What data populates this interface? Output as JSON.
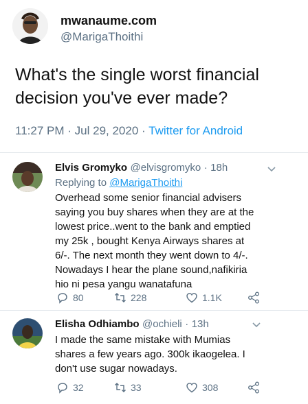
{
  "tweet": {
    "display_name": "mwanaume.com",
    "handle": "@MarigaThoithi",
    "text": "What's the single worst financial decision you've ever made?",
    "time": "11:27 PM",
    "sep1": "·",
    "date": "Jul 29, 2020",
    "sep2": "·",
    "source": "Twitter for Android"
  },
  "replies": [
    {
      "name": "Elvis Gromyko",
      "handle": "@elvisgromyko",
      "sep": "·",
      "age": "18h",
      "replying_prefix": "Replying to",
      "replying_to": "@MarigaThoithi",
      "text": "Overhead some senior financial advisers saying you buy shares when they are at the lowest price..went to the bank and emptied my 25k , bought Kenya Airways shares at 6/-. The next month they went down to 4/-. Nowadays I hear the plane sound,nafikiria hio ni pesa yangu wanatafuna",
      "replies_count": "80",
      "retweets_count": "228",
      "likes_count": "1.1K"
    },
    {
      "name": "Elisha Odhiambo",
      "handle": "@ochieli",
      "sep": "·",
      "age": "13h",
      "text": "I made the same mistake with Mumias shares a few years ago. 300k ikaogelea. I don't use sugar nowadays.",
      "replies_count": "32",
      "retweets_count": "33",
      "likes_count": "308"
    }
  ],
  "colors": {
    "link": "#1d9bf0",
    "secondary_text": "#5b7083",
    "divider": "#e3e8ec"
  },
  "icons": [
    "chevron-down-icon",
    "reply-icon",
    "retweet-icon",
    "like-icon",
    "share-icon"
  ]
}
